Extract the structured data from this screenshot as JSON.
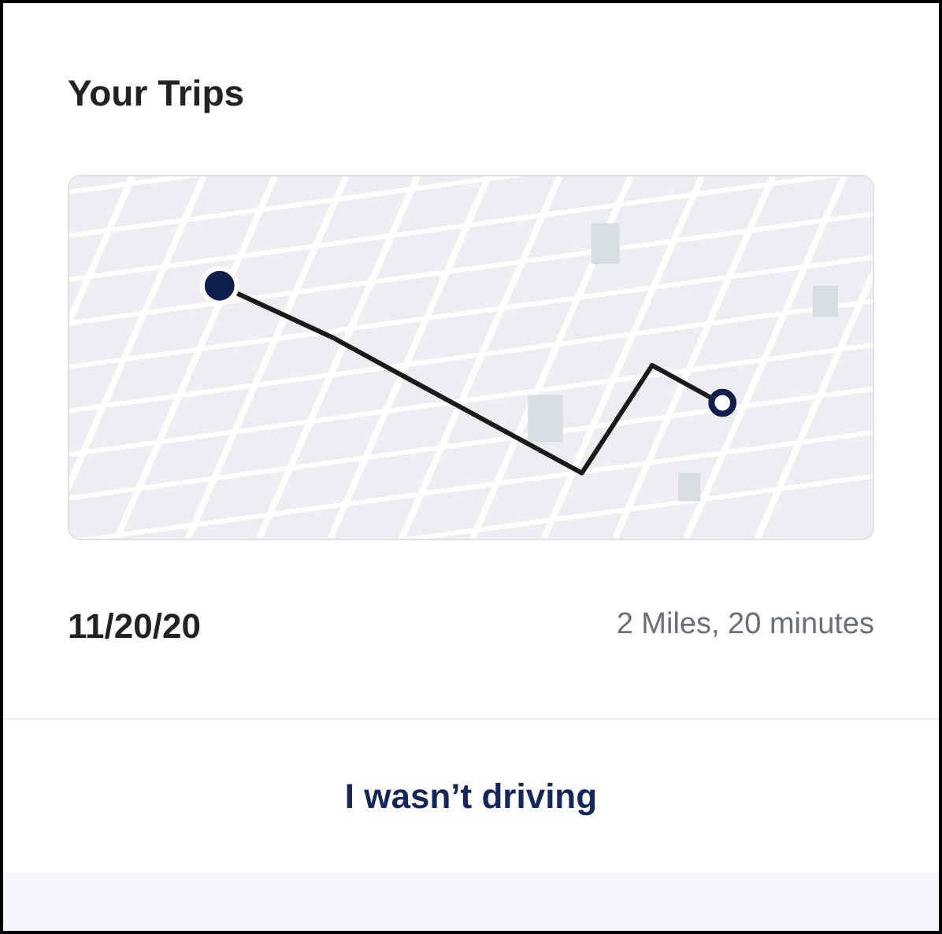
{
  "card": {
    "title": "Your Trips",
    "trip": {
      "date": "11/20/20",
      "summary": "2 Miles, 20 minutes"
    },
    "action": "I wasn’t driving"
  }
}
